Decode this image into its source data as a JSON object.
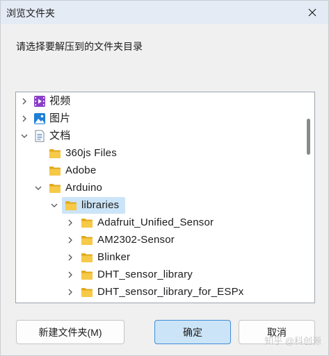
{
  "window": {
    "title": "浏览文件夹",
    "prompt": "请选择要解压到的文件夹目录"
  },
  "tree": {
    "items": [
      {
        "label": "视频",
        "icon": "video-library-icon",
        "chevron": "right"
      },
      {
        "label": "图片",
        "icon": "pictures-library-icon",
        "chevron": "right"
      },
      {
        "label": "文档",
        "icon": "documents-library-icon",
        "chevron": "down"
      },
      {
        "label": "360js Files",
        "icon": "folder-icon",
        "chevron": "none"
      },
      {
        "label": "Adobe",
        "icon": "folder-icon",
        "chevron": "none"
      },
      {
        "label": "Arduino",
        "icon": "folder-icon",
        "chevron": "down"
      },
      {
        "label": "libraries",
        "icon": "folder-icon",
        "chevron": "down",
        "selected": true
      },
      {
        "label": "Adafruit_Unified_Sensor",
        "icon": "folder-icon",
        "chevron": "right"
      },
      {
        "label": "AM2302-Sensor",
        "icon": "folder-icon",
        "chevron": "right"
      },
      {
        "label": "Blinker",
        "icon": "folder-icon",
        "chevron": "right"
      },
      {
        "label": "DHT_sensor_library",
        "icon": "folder-icon",
        "chevron": "right"
      },
      {
        "label": "DHT_sensor_library_for_ESPx",
        "icon": "folder-icon",
        "chevron": "right"
      }
    ]
  },
  "buttons": {
    "new_folder": "新建文件夹(M)",
    "ok": "确定",
    "cancel": "取消"
  },
  "watermark": "知乎 @科创源",
  "colors": {
    "selection": "#cce4f7",
    "primary_border": "#3d8bd6",
    "folder": "#f3c54a"
  }
}
